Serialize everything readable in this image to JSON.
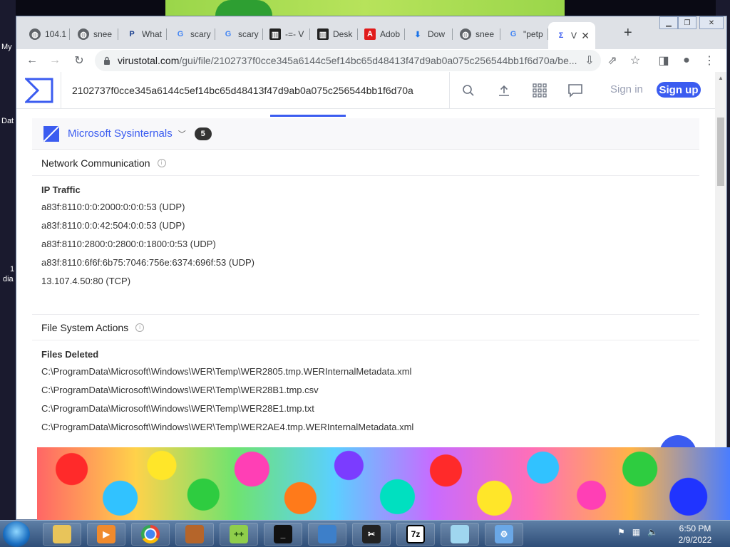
{
  "desktop": {
    "labels": [
      "My",
      "Dat",
      "1",
      "dia"
    ]
  },
  "browser": {
    "tabs": [
      {
        "label": "104.1",
        "icon": "globe-icon"
      },
      {
        "label": "snee",
        "icon": "globe-icon"
      },
      {
        "label": "What",
        "icon": "paypal-icon"
      },
      {
        "label": "scary",
        "icon": "google-icon"
      },
      {
        "label": "scary",
        "icon": "google-icon"
      },
      {
        "label": "-=- V",
        "icon": "archive-icon"
      },
      {
        "label": "Desk",
        "icon": "archive-icon"
      },
      {
        "label": "Adob",
        "icon": "adobe-icon"
      },
      {
        "label": "Dow",
        "icon": "download-icon"
      },
      {
        "label": "snee",
        "icon": "globe-icon"
      },
      {
        "label": "\"petp",
        "icon": "google-icon"
      },
      {
        "label": "V",
        "icon": "virustotal-icon"
      }
    ],
    "url_host": "virustotal.com",
    "url_path": "/gui/file/2102737f0cce345a6144c5ef14bc65d48413f47d9ab0a075c256544bb1f6d70a/be..."
  },
  "vt": {
    "search_value": "2102737f0cce345a6144c5ef14bc65d48413f47d9ab0a075c256544bb1f6d70a",
    "sign_in": "Sign in",
    "sign_up": "Sign up",
    "sandbox_name": "Microsoft Sysinternals",
    "sandbox_count": "5",
    "network": {
      "title": "Network Communication",
      "sub": "IP Traffic",
      "rows": [
        "a83f:8110:0:0:2000:0:0:0:53 (UDP)",
        "a83f:8110:0:0:42:504:0:0:53 (UDP)",
        "a83f:8110:2800:0:2800:0:1800:0:53 (UDP)",
        "a83f:8110:6f6f:6b75:7046:756e:6374:696f:53 (UDP)",
        "13.107.4.50:80 (TCP)"
      ]
    },
    "filesystem": {
      "title": "File System Actions",
      "sub": "Files Deleted",
      "rows": [
        "C:\\ProgramData\\Microsoft\\Windows\\WER\\Temp\\WER2805.tmp.WERInternalMetadata.xml",
        "C:\\ProgramData\\Microsoft\\Windows\\WER\\Temp\\WER28B1.tmp.csv",
        "C:\\ProgramData\\Microsoft\\Windows\\WER\\Temp\\WER28E1.tmp.txt",
        "C:\\ProgramData\\Microsoft\\Windows\\WER\\Temp\\WER2AE4.tmp.WERInternalMetadata.xml"
      ]
    }
  },
  "taskbar": {
    "apps": [
      {
        "name": "explorer",
        "label": ""
      },
      {
        "name": "media-player",
        "label": ""
      },
      {
        "name": "chrome",
        "label": ""
      },
      {
        "name": "app-4",
        "label": ""
      },
      {
        "name": "notepad-plus",
        "label": ""
      },
      {
        "name": "cmd",
        "label": ""
      },
      {
        "name": "app-7",
        "label": ""
      },
      {
        "name": "app-8",
        "label": ""
      },
      {
        "name": "7zip",
        "label": "7z"
      },
      {
        "name": "notepad",
        "label": ""
      },
      {
        "name": "control-panel",
        "label": ""
      }
    ],
    "time": "6:50 PM",
    "date": "2/9/2022"
  },
  "colors": {
    "vt_blue": "#3b5cf0",
    "chrome_tab_bg": "#dee1e6"
  }
}
